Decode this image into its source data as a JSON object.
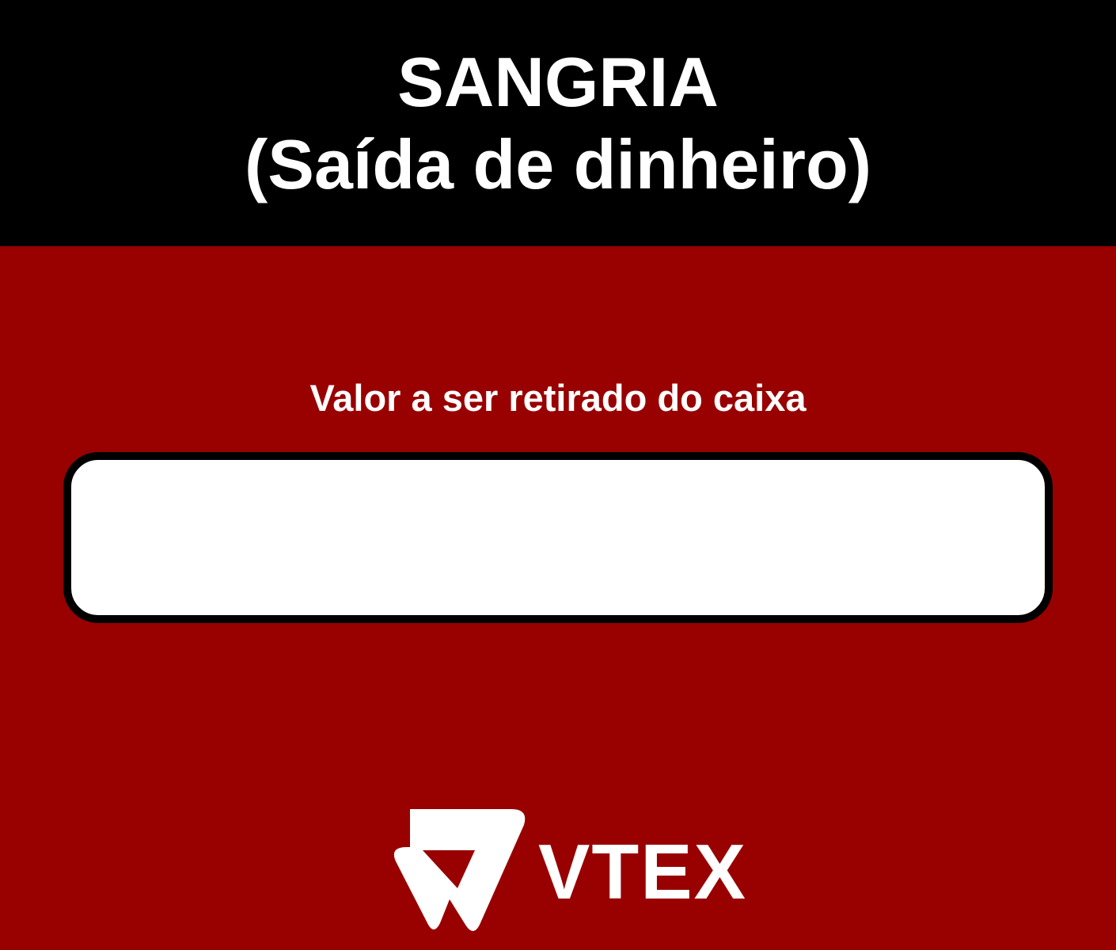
{
  "header": {
    "title_line1": "SANGRIA",
    "title_line2": "(Saída de dinheiro)"
  },
  "form": {
    "amount_label": "Valor a ser retirado do caixa",
    "amount_value": ""
  },
  "brand": {
    "name": "VTEX"
  },
  "colors": {
    "header_bg": "#000000",
    "body_bg": "#990000",
    "text": "#ffffff",
    "input_bg": "#ffffff",
    "input_border": "#000000"
  }
}
